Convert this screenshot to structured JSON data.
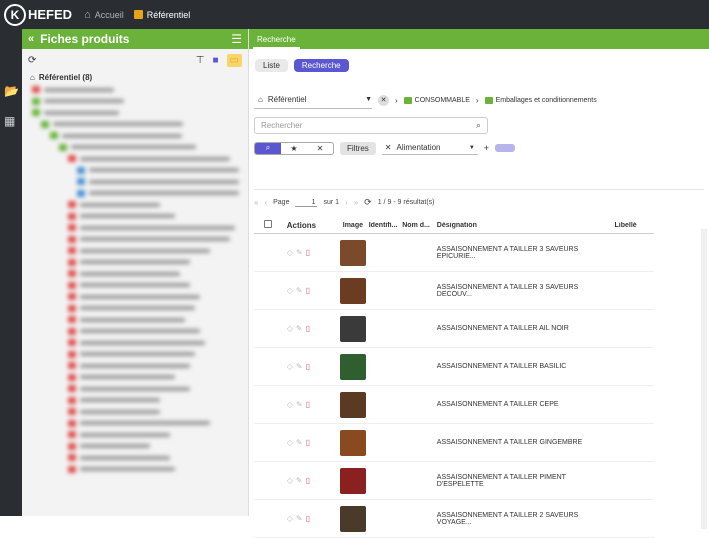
{
  "app": {
    "logo_text": "HEFED",
    "logo_mark": "K"
  },
  "topnav": {
    "home_label": "Accueil",
    "ref_label": "Référentiel"
  },
  "left_panel": {
    "title": "Fiches produits",
    "root_label": "Référentiel (8)"
  },
  "main": {
    "tab_label": "Recherche",
    "view_tabs": [
      "Liste",
      "Recherche"
    ],
    "ref_select": "Référentiel",
    "breadcrumb": [
      "CONSOMMABLE",
      "Emballages et conditionnements"
    ],
    "search_placeholder": "Rechercher",
    "filters_label": "Filtres",
    "criterion": "Alimentation"
  },
  "pager": {
    "page_label": "Page",
    "page_value": "1",
    "of_label": "sur 1",
    "results": "1 / 9 - 9 résultat(s)"
  },
  "table": {
    "columns": [
      "Actions",
      "Image",
      "Identifi...",
      "Nom d...",
      "Désignation",
      "Libellé"
    ],
    "rows": [
      {
        "designation": "ASSAISONNEMENT A TAILLER 3 SAVEURS EPICURIE..."
      },
      {
        "designation": "ASSAISONNEMENT A TAILLER 3 SAVEURS DECOUV..."
      },
      {
        "designation": "ASSAISONNEMENT A TAILLER AIL NOIR"
      },
      {
        "designation": "ASSAISONNEMENT A TAILLER BASILIC"
      },
      {
        "designation": "ASSAISONNEMENT A TAILLER CEPE"
      },
      {
        "designation": "ASSAISONNEMENT A TAILLER GINGEMBRE"
      },
      {
        "designation": "ASSAISONNEMENT A TAILLER PIMENT D'ESPELETTE"
      },
      {
        "designation": "ASSAISONNEMENT A TAILLER 2 SAVEURS VOYAGE..."
      }
    ]
  },
  "colors": {
    "green": "#6bb23b",
    "purple": "#5b57d1",
    "dark": "#2a2e33",
    "amber": "#e8a317"
  }
}
